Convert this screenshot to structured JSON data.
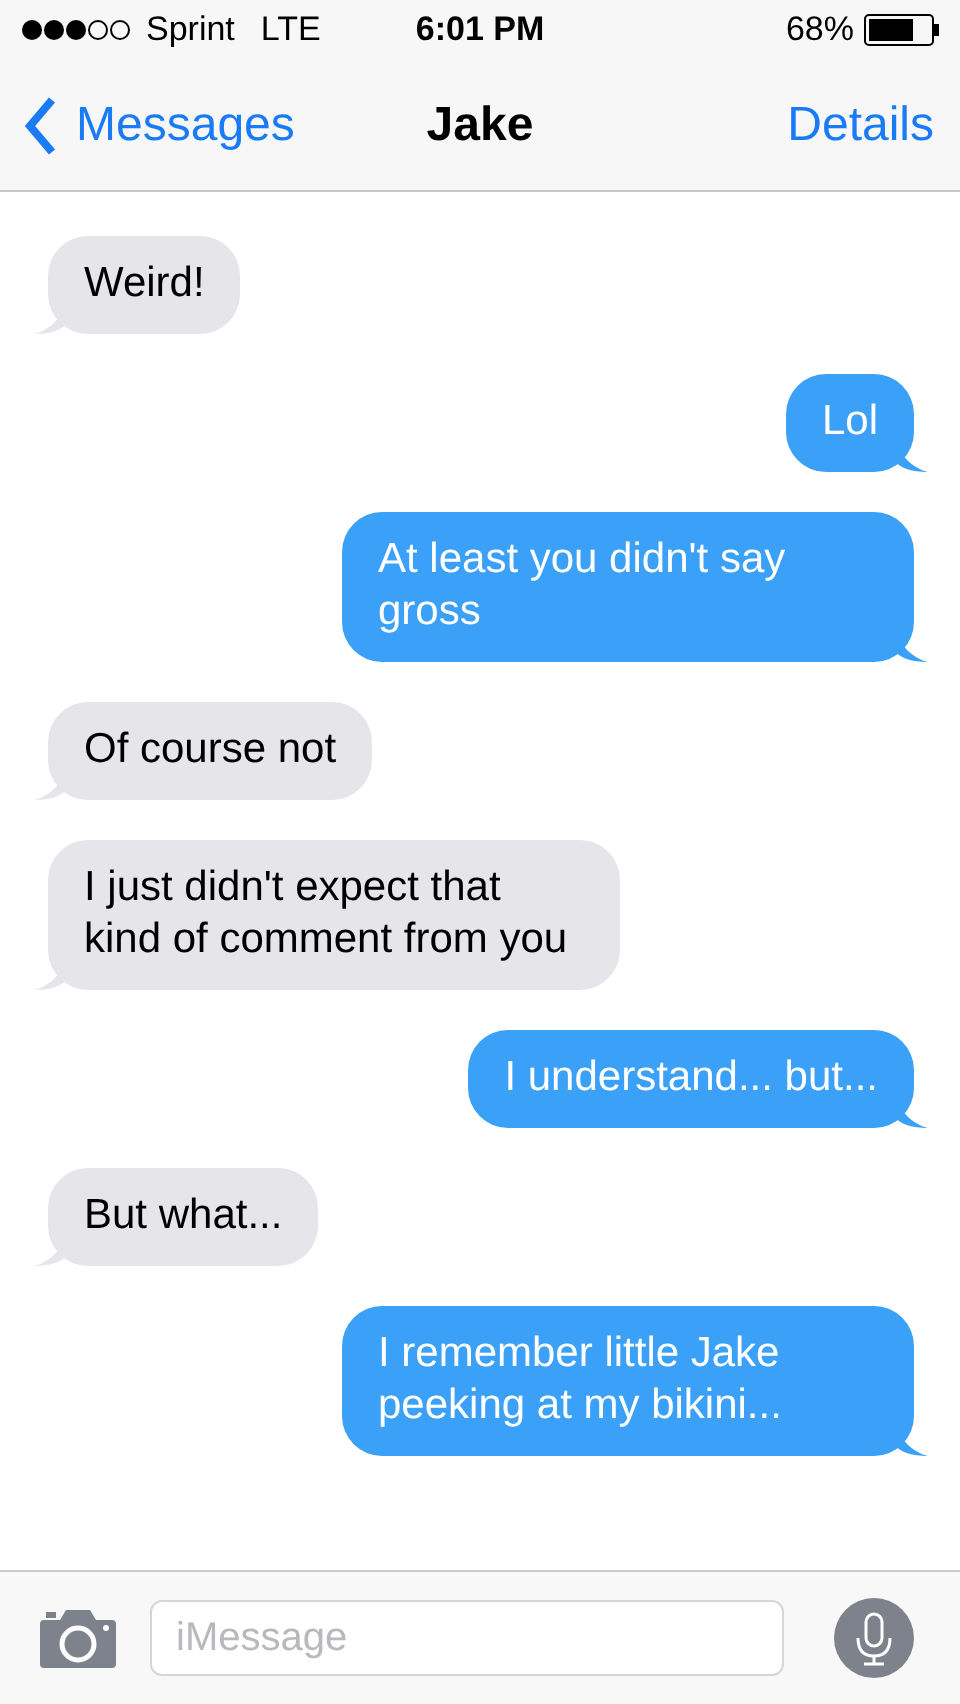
{
  "status_bar": {
    "carrier": "Sprint",
    "network": "LTE",
    "time": "6:01 PM",
    "battery": "68%"
  },
  "nav": {
    "back": "Messages",
    "title": "Jake",
    "action": "Details"
  },
  "messages": [
    {
      "kind": "received",
      "text": "Weird!"
    },
    {
      "kind": "sent",
      "text": "Lol"
    },
    {
      "kind": "sent",
      "text": "At least you didn't say gross"
    },
    {
      "kind": "received",
      "text": "Of course not"
    },
    {
      "kind": "received",
      "text": "I just didn't expect that kind of comment from you"
    },
    {
      "kind": "sent",
      "text": "I understand... but..."
    },
    {
      "kind": "received",
      "text": "But what..."
    },
    {
      "kind": "sent",
      "text": "I remember little Jake peeking at my bikini..."
    }
  ],
  "composer": {
    "placeholder": "iMessage"
  }
}
